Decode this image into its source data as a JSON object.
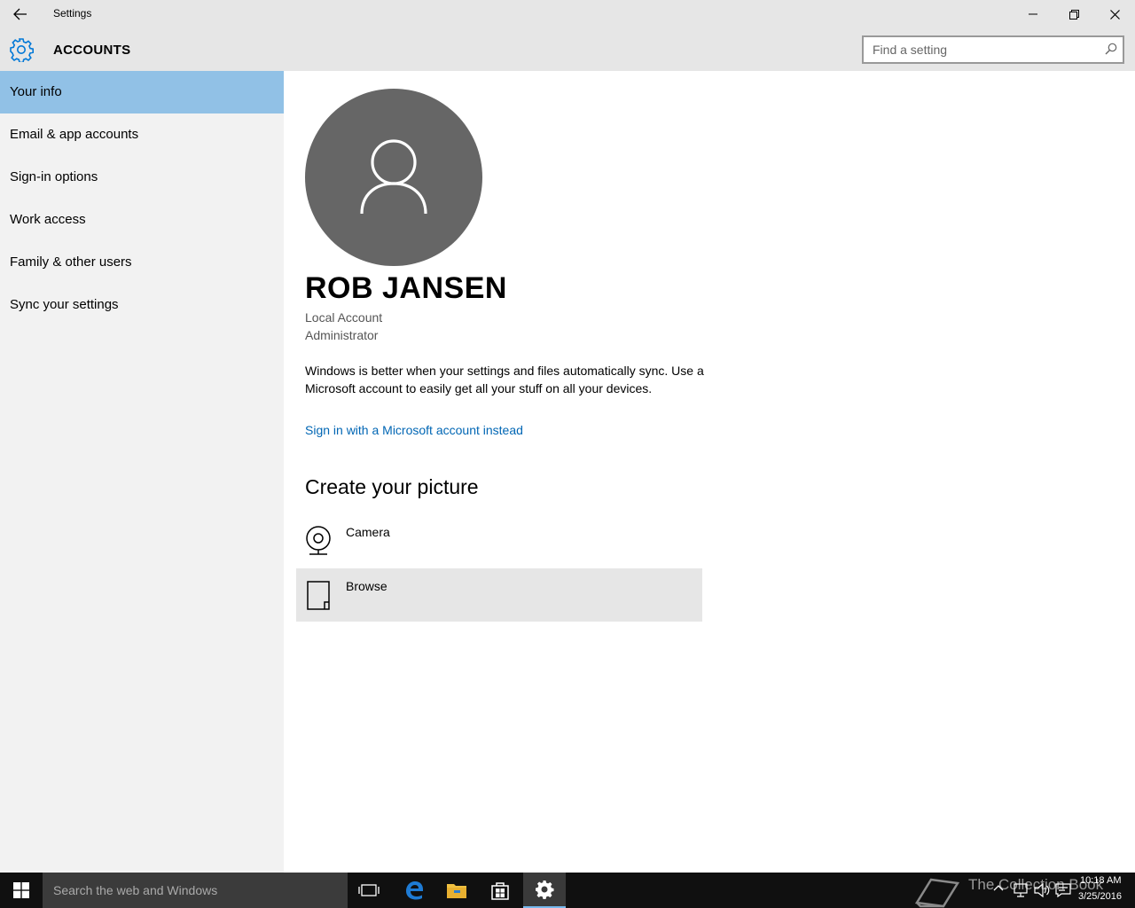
{
  "window": {
    "title": "Settings",
    "buttons": {
      "minimize": "minimize",
      "restore": "restore",
      "close": "close"
    }
  },
  "header": {
    "section": "ACCOUNTS",
    "search_placeholder": "Find a setting",
    "accent": "#0078d7"
  },
  "sidebar": {
    "items": [
      {
        "label": "Your info",
        "active": true
      },
      {
        "label": "Email & app accounts",
        "active": false
      },
      {
        "label": "Sign-in options",
        "active": false
      },
      {
        "label": "Work access",
        "active": false
      },
      {
        "label": "Family & other users",
        "active": false
      },
      {
        "label": "Sync your settings",
        "active": false
      }
    ],
    "active_color": "#91c1e6"
  },
  "main": {
    "user_name": "ROB JANSEN",
    "account_type": "Local Account",
    "account_role": "Administrator",
    "sync_text": "Windows is better when your settings and files automatically sync. Use a Microsoft account to easily get all your stuff on all your devices.",
    "ms_link": "Sign in with a Microsoft account instead",
    "picture_heading": "Create your picture",
    "picture_options": [
      {
        "label": "Camera",
        "icon": "camera-icon"
      },
      {
        "label": "Browse",
        "icon": "browse-icon"
      }
    ],
    "link_color": "#0066b4"
  },
  "taskbar": {
    "search_placeholder": "Search the web and Windows",
    "apps": [
      "task-view-icon",
      "edge-icon",
      "file-explorer-icon",
      "store-icon",
      "settings-icon"
    ],
    "watermark": "The Collection Book",
    "time": "10:18 AM",
    "date": "3/25/2016"
  }
}
